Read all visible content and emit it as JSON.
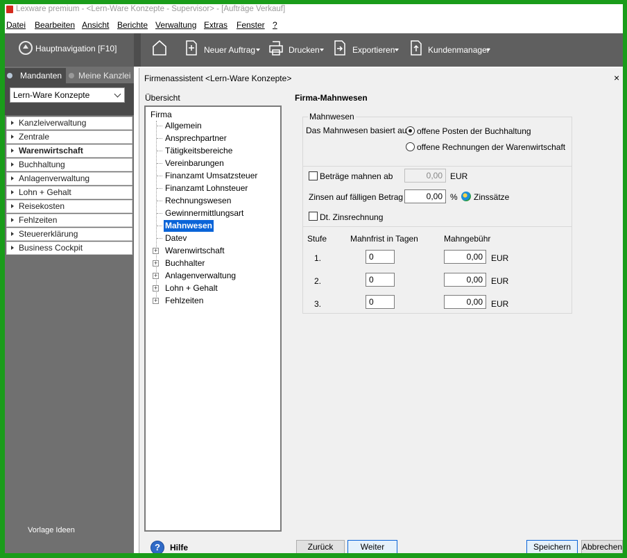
{
  "window": {
    "title": "Lexware premium - <Lern-Ware Konzepte - Supervisor> - [Aufträge Verkauf]"
  },
  "menu": [
    "Datei",
    "Bearbeiten",
    "Ansicht",
    "Berichte",
    "Verwaltung",
    "Extras",
    "Fenster",
    "?"
  ],
  "nav": {
    "hauptnavigation": "Hauptnavigation [F10]",
    "tabs": [
      "Mandanten",
      "Meine Kanzlei"
    ],
    "mandant": "Lern-Ware Konzepte",
    "items": [
      "Kanzleiverwaltung",
      "Zentrale",
      "Warenwirtschaft",
      "Buchhaltung",
      "Anlagenverwaltung",
      "Lohn + Gehalt",
      "Reisekosten",
      "Fehlzeiten",
      "Steuererklärung",
      "Business Cockpit"
    ],
    "footer": "Vorlage Ideen"
  },
  "toolbar": [
    "Neuer Auftrag",
    "Drucken",
    "Exportieren",
    "Kundenmanager"
  ],
  "dialog": {
    "title": "Firmenassistent <Lern-Ware Konzepte>",
    "close": "×",
    "overview_label": "Übersicht",
    "tree_root": "Firma",
    "tree_items": [
      "Allgemein",
      "Ansprechpartner",
      "Tätigkeitsbereiche",
      "Vereinbarungen",
      "Finanzamt Umsatzsteuer",
      "Finanzamt Lohnsteuer",
      "Rechnungswesen",
      "Gewinnermittlungsart",
      "Mahnwesen",
      "Datev"
    ],
    "tree_groups": [
      "Warenwirtschaft",
      "Buchhalter",
      "Anlagenverwaltung",
      "Lohn + Gehalt",
      "Fehlzeiten"
    ],
    "section_title": "Firma-Mahnwesen",
    "group_title": "Mahnwesen",
    "based_on_label": "Das Mahnwesen basiert auf",
    "radio_1": "offene Posten der Buchhaltung",
    "radio_2": "offene Rechnungen der Warenwirtschaft",
    "betraege_label": "Beträge mahnen ab",
    "betraege_value": "0,00",
    "betraege_unit": "EUR",
    "zinsen_label": "Zinsen auf fälligen Betrag",
    "zinsen_value": "0,00",
    "zinsen_unit": "%",
    "zinssaetze": "Zinssätze",
    "dt_zins_label": "Dt. Zinsrechnung",
    "table_headers": [
      "Stufe",
      "Mahnfrist in Tagen",
      "Mahngebühr"
    ],
    "levels": [
      {
        "stufe": "1.",
        "frist": "0",
        "gebuehr": "0,00",
        "unit": "EUR"
      },
      {
        "stufe": "2.",
        "frist": "0",
        "gebuehr": "0,00",
        "unit": "EUR"
      },
      {
        "stufe": "3.",
        "frist": "0",
        "gebuehr": "0,00",
        "unit": "EUR"
      }
    ],
    "help_label": "Hilfe",
    "help_icon": "?",
    "buttons": {
      "back": "Zurück",
      "next": "Weiter",
      "save": "Speichern",
      "cancel": "Abbrechen"
    }
  }
}
